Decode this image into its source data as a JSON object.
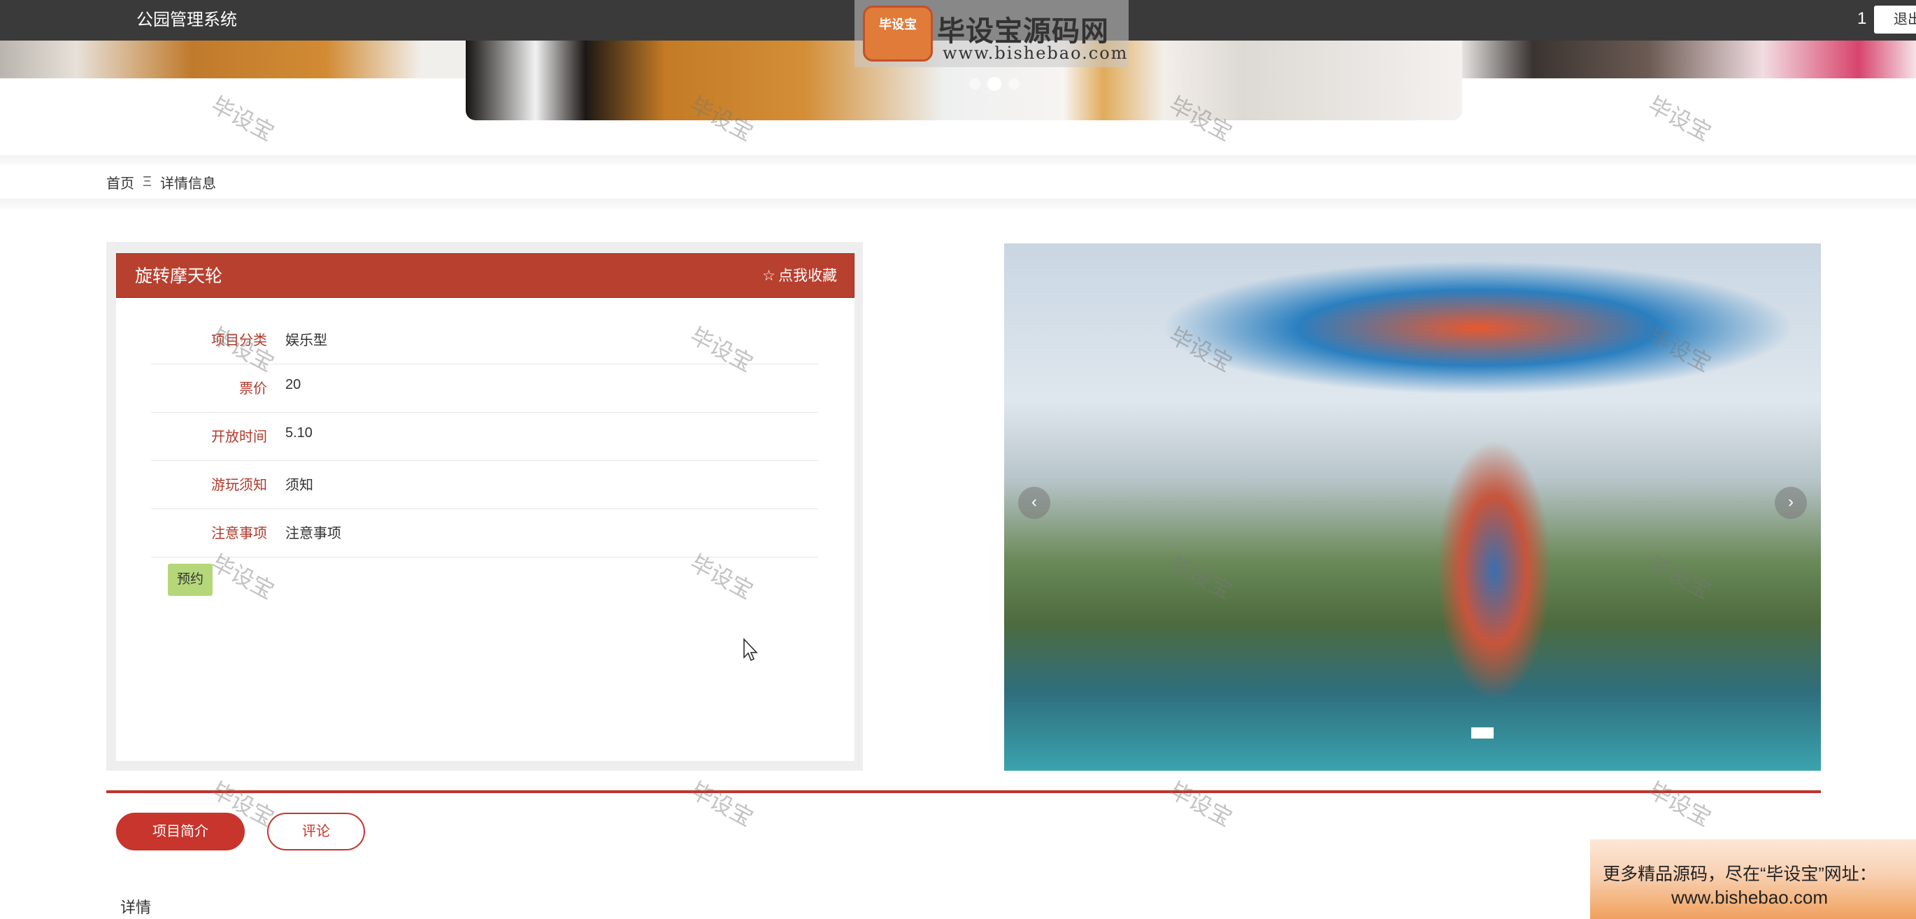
{
  "header": {
    "app_title": "公园管理系统",
    "user": "1",
    "logout_label": "退出"
  },
  "watermark": {
    "logo_badge": "毕设宝",
    "brand": "毕设宝源码网",
    "url": "www.bishebao.com",
    "tile_text": "毕设宝"
  },
  "breadcrumb": {
    "home": "首页",
    "separator": "Ξ",
    "current": "详情信息"
  },
  "detail": {
    "name": "旋转摩天轮",
    "favorite_label": "点我收藏",
    "fields": [
      {
        "label": "项目分类",
        "value": "娱乐型"
      },
      {
        "label": "票价",
        "value": "20"
      },
      {
        "label": "开放时间",
        "value": "5.10"
      },
      {
        "label": "游玩须知",
        "value": "须知"
      },
      {
        "label": "注意事项",
        "value": "注意事项"
      }
    ],
    "book_label": "预约"
  },
  "tabs": {
    "intro": "项目简介",
    "comments": "评论"
  },
  "section_title": "详情",
  "ad": {
    "line1": "更多精品源码，尽在“毕设宝”网址：",
    "line2": "www.bishebao.com"
  },
  "colors": {
    "topbar": "#3a3a3a",
    "accent_red": "#c7352c",
    "card_head": "#b8402f",
    "book_button": "#b5d77a"
  }
}
